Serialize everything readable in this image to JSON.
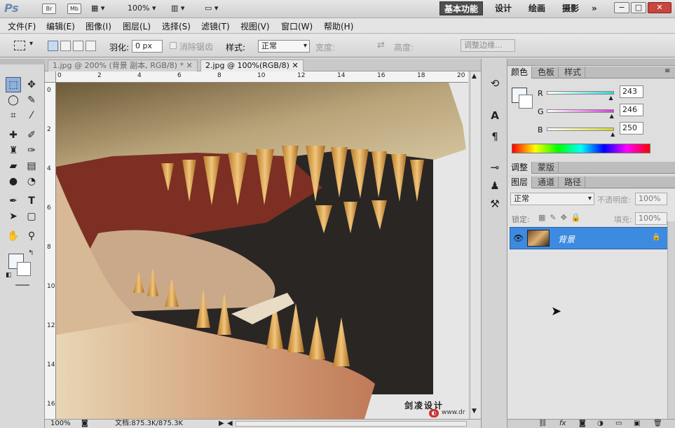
{
  "app": {
    "logo": "Ps",
    "toolbar_icons": [
      "Br",
      "Mb"
    ],
    "zoom": "100%",
    "workspaces": [
      {
        "label": "基本功能",
        "active": true
      },
      {
        "label": "设计",
        "active": false
      },
      {
        "label": "绘画",
        "active": false
      },
      {
        "label": "摄影",
        "active": false
      }
    ],
    "more": "»",
    "window_buttons": [
      "−",
      "□",
      "✕"
    ]
  },
  "menu": [
    "文件(F)",
    "编辑(E)",
    "图像(I)",
    "图层(L)",
    "选择(S)",
    "滤镜(T)",
    "视图(V)",
    "窗口(W)",
    "帮助(H)"
  ],
  "options": {
    "feather_label": "羽化:",
    "feather_value": "0 px",
    "antialias_label": "消除锯齿",
    "style_label": "样式:",
    "style_value": "正常",
    "width_label": "宽度:",
    "height_label": "高度:",
    "refine_edge": "调整边缘..."
  },
  "documents": [
    {
      "title": "1.jpg @ 200% (背景 副本, RGB/8) *",
      "close": "✕",
      "active": false
    },
    {
      "title": "2.jpg @ 100%(RGB/8)",
      "close": "✕",
      "active": true
    }
  ],
  "ruler_h": [
    "0",
    "2",
    "4",
    "6",
    "8",
    "10",
    "12",
    "14",
    "16",
    "18",
    "20"
  ],
  "ruler_v": [
    "0",
    "2",
    "4",
    "6",
    "8",
    "10",
    "12",
    "14",
    "16"
  ],
  "canvas": {
    "watermark_title": "剑凌设计",
    "watermark_url": "www.dr"
  },
  "status": {
    "zoom": "100%",
    "doc": "文档:875.3K/875.3K"
  },
  "color_panel": {
    "tabs": [
      {
        "label": "颜色",
        "active": true
      },
      {
        "label": "色板",
        "active": false
      },
      {
        "label": "样式",
        "active": false
      }
    ],
    "channels": [
      {
        "label": "R",
        "value": "243",
        "color": "#33d6d6"
      },
      {
        "label": "G",
        "value": "246",
        "color": "#d63fd6"
      },
      {
        "label": "B",
        "value": "250",
        "color": "#d6d62f"
      }
    ]
  },
  "adjust_panel": {
    "tabs": [
      {
        "label": "调整",
        "active": true
      },
      {
        "label": "蒙版",
        "active": false
      }
    ]
  },
  "layers_panel": {
    "tabs": [
      {
        "label": "图层",
        "active": true
      },
      {
        "label": "通道",
        "active": false
      },
      {
        "label": "路径",
        "active": false
      }
    ],
    "blend_mode": "正常",
    "opacity_label": "不透明度:",
    "opacity_value": "100%",
    "lock_label": "锁定:",
    "fill_label": "填充:",
    "fill_value": "100%",
    "layers": [
      {
        "name": "背景",
        "visible": true,
        "locked": true
      }
    ]
  },
  "accent_color": "#3d8be0"
}
